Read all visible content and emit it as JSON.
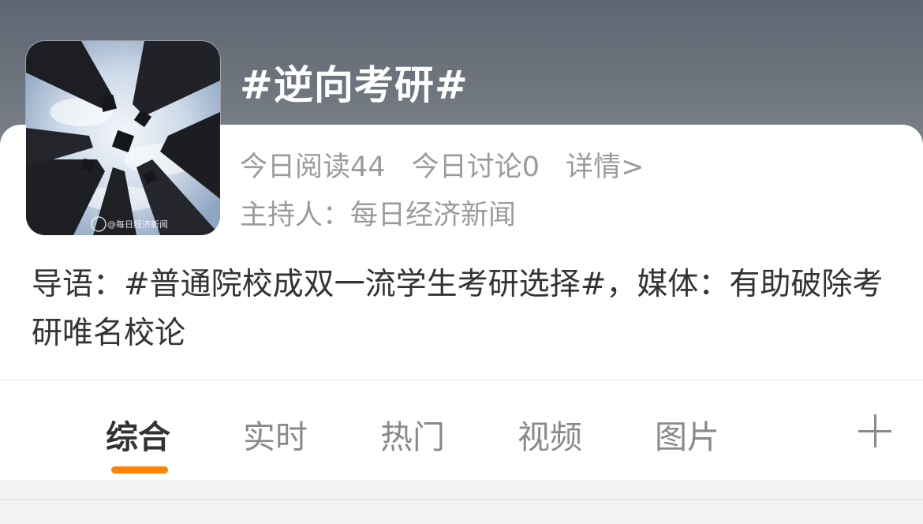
{
  "topic": {
    "title": "#逆向考研#",
    "stats": {
      "reads_today": "今日阅读44",
      "discussion_today": "今日讨论0",
      "details_link": "详情>"
    },
    "host": "主持人：每日经济新闻",
    "avatar_watermark": "@每日经济新闻"
  },
  "intro": {
    "text": "导语：#普通院校成双一流学生考研选择#，媒体：有助破除考研唯名校论"
  },
  "tabs": [
    {
      "label": "综合",
      "active": true
    },
    {
      "label": "实时",
      "active": false
    },
    {
      "label": "热门",
      "active": false
    },
    {
      "label": "视频",
      "active": false
    },
    {
      "label": "图片",
      "active": false
    }
  ],
  "colors": {
    "accent": "#ff8200",
    "header_bg": "#6b717b",
    "muted_text": "#9b9b9b",
    "body_text": "#333333"
  },
  "icons": {
    "add_tab": "plus-icon"
  }
}
